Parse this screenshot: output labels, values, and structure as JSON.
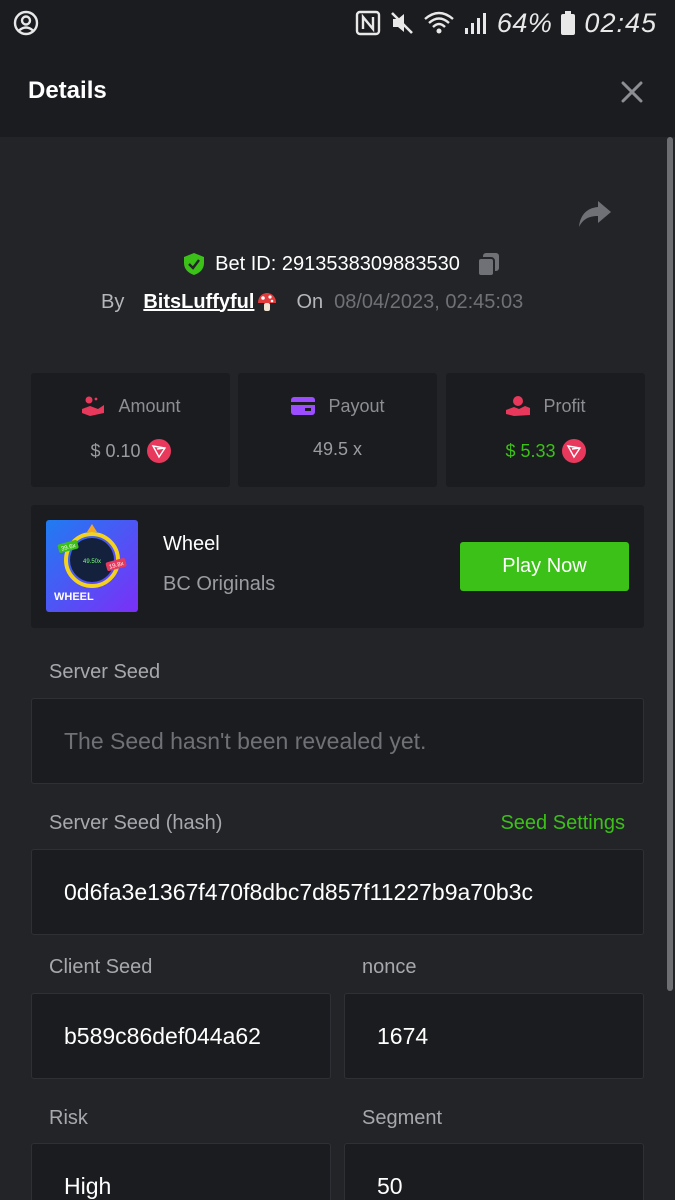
{
  "status_bar": {
    "battery": "64%",
    "time": "02:45"
  },
  "header": {
    "title": "Details"
  },
  "bet": {
    "id_label": "Bet ID: 2913538309883530",
    "by_label": "By",
    "username": "BitsLuffyful",
    "on_label": "On",
    "datetime": "08/04/2023, 02:45:03"
  },
  "stats": [
    {
      "label": "Amount",
      "value": "$ 0.10",
      "icon": "coins-hand-icon",
      "color": "#e8395c",
      "coin": true
    },
    {
      "label": "Payout",
      "value": "49.5 x",
      "icon": "card-icon",
      "color": "#9b4dff",
      "coin": false
    },
    {
      "label": "Profit",
      "value": "$ 5.33",
      "icon": "profit-hand-icon",
      "color": "#e8395c",
      "coin": true
    }
  ],
  "game": {
    "name": "Wheel",
    "provider": "BC Originals",
    "play_label": "Play Now",
    "thumb_title": "WHEEL",
    "thumb_badges": [
      "39.6x",
      "49.50x",
      "19.8x"
    ]
  },
  "fields": {
    "server_seed_label": "Server Seed",
    "server_seed_value": "The Seed hasn't been revealed yet.",
    "server_hash_label": "Server Seed (hash)",
    "seed_settings_label": "Seed Settings",
    "server_hash_value": "0d6fa3e1367f470f8dbc7d857f11227b9a70b3c",
    "client_seed_label": "Client Seed",
    "client_seed_value": "b589c86def044a62",
    "nonce_label": "nonce",
    "nonce_value": "1674",
    "risk_label": "Risk",
    "risk_value": "High",
    "segment_label": "Segment",
    "segment_value": "50"
  },
  "colors": {
    "accent_green": "#3bc117",
    "background": "#232428",
    "card": "#1b1c1f"
  }
}
